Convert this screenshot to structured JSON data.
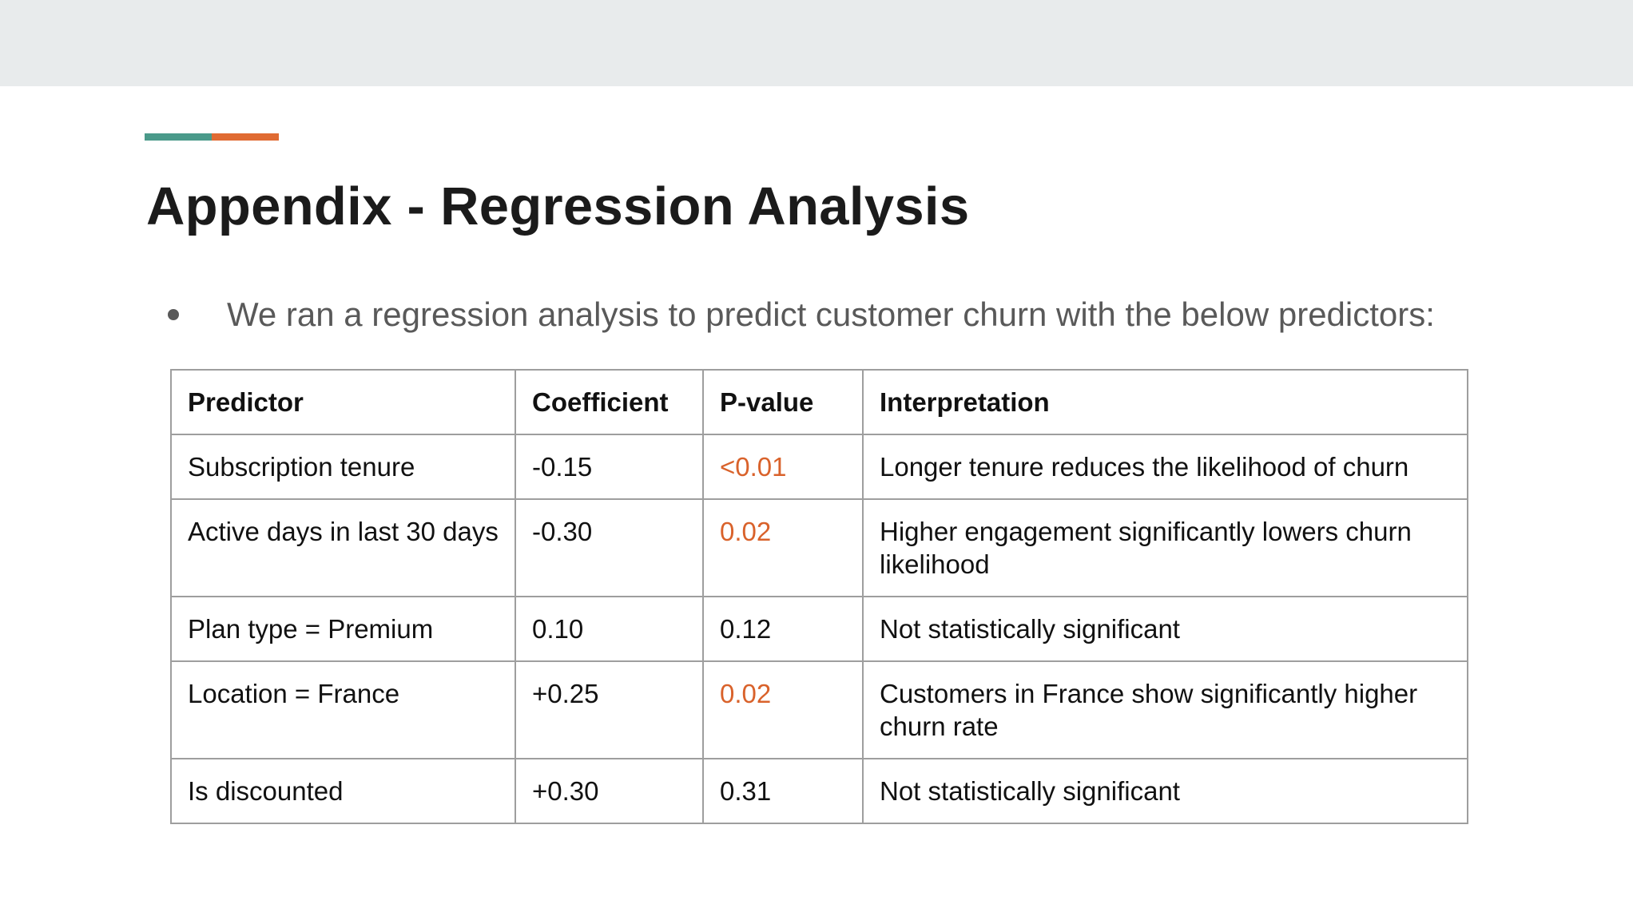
{
  "colors": {
    "top_bar": "#e8ebec",
    "accent_teal": "#4a9a8a",
    "accent_orange": "#e06b33",
    "significant_value": "#d9622b",
    "title_text": "#1b1b1b",
    "bullet_text": "#595959"
  },
  "slide": {
    "title": "Appendix - Regression Analysis",
    "bullet": "We ran a regression analysis to predict customer churn with the below predictors:"
  },
  "table": {
    "headers": [
      "Predictor",
      "Coefficient",
      "P-value",
      "Interpretation"
    ],
    "rows": [
      {
        "predictor": "Subscription tenure",
        "coefficient": "-0.15",
        "p_value": "<0.01",
        "significant": true,
        "interpretation": "Longer tenure reduces the likelihood of churn"
      },
      {
        "predictor": "Active days in last 30 days",
        "coefficient": "-0.30",
        "p_value": "0.02",
        "significant": true,
        "interpretation": "Higher engagement significantly lowers churn likelihood"
      },
      {
        "predictor": "Plan type = Premium",
        "coefficient": "0.10",
        "p_value": "0.12",
        "significant": false,
        "interpretation": "Not statistically significant"
      },
      {
        "predictor": "Location = France",
        "coefficient": "+0.25",
        "p_value": "0.02",
        "significant": true,
        "interpretation": "Customers in France show significantly higher churn rate"
      },
      {
        "predictor": "Is discounted",
        "coefficient": "+0.30",
        "p_value": "0.31",
        "significant": false,
        "interpretation": "Not statistically significant"
      }
    ]
  }
}
